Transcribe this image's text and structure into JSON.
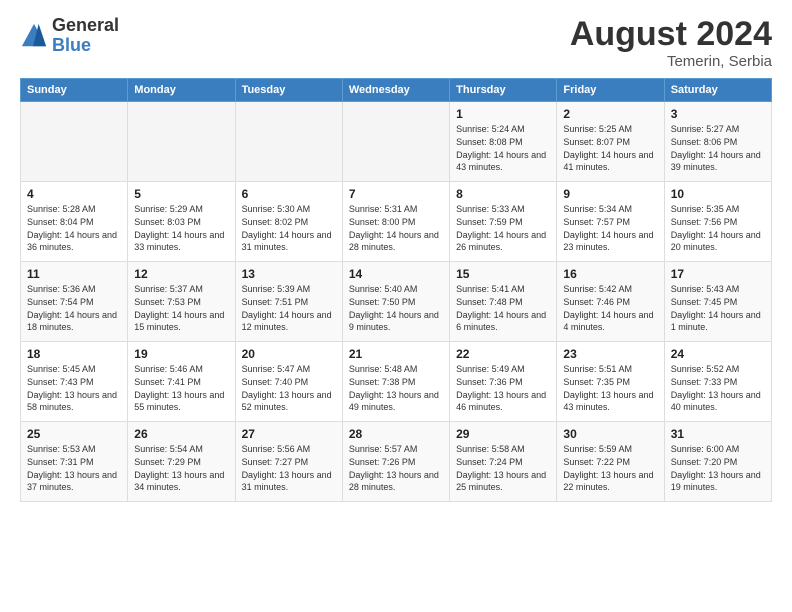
{
  "header": {
    "logo_general": "General",
    "logo_blue": "Blue",
    "month_year": "August 2024",
    "location": "Temerin, Serbia"
  },
  "weekdays": [
    "Sunday",
    "Monday",
    "Tuesday",
    "Wednesday",
    "Thursday",
    "Friday",
    "Saturday"
  ],
  "weeks": [
    [
      {
        "day": "",
        "info": ""
      },
      {
        "day": "",
        "info": ""
      },
      {
        "day": "",
        "info": ""
      },
      {
        "day": "",
        "info": ""
      },
      {
        "day": "1",
        "info": "Sunrise: 5:24 AM\nSunset: 8:08 PM\nDaylight: 14 hours and 43 minutes."
      },
      {
        "day": "2",
        "info": "Sunrise: 5:25 AM\nSunset: 8:07 PM\nDaylight: 14 hours and 41 minutes."
      },
      {
        "day": "3",
        "info": "Sunrise: 5:27 AM\nSunset: 8:06 PM\nDaylight: 14 hours and 39 minutes."
      }
    ],
    [
      {
        "day": "4",
        "info": "Sunrise: 5:28 AM\nSunset: 8:04 PM\nDaylight: 14 hours and 36 minutes."
      },
      {
        "day": "5",
        "info": "Sunrise: 5:29 AM\nSunset: 8:03 PM\nDaylight: 14 hours and 33 minutes."
      },
      {
        "day": "6",
        "info": "Sunrise: 5:30 AM\nSunset: 8:02 PM\nDaylight: 14 hours and 31 minutes."
      },
      {
        "day": "7",
        "info": "Sunrise: 5:31 AM\nSunset: 8:00 PM\nDaylight: 14 hours and 28 minutes."
      },
      {
        "day": "8",
        "info": "Sunrise: 5:33 AM\nSunset: 7:59 PM\nDaylight: 14 hours and 26 minutes."
      },
      {
        "day": "9",
        "info": "Sunrise: 5:34 AM\nSunset: 7:57 PM\nDaylight: 14 hours and 23 minutes."
      },
      {
        "day": "10",
        "info": "Sunrise: 5:35 AM\nSunset: 7:56 PM\nDaylight: 14 hours and 20 minutes."
      }
    ],
    [
      {
        "day": "11",
        "info": "Sunrise: 5:36 AM\nSunset: 7:54 PM\nDaylight: 14 hours and 18 minutes."
      },
      {
        "day": "12",
        "info": "Sunrise: 5:37 AM\nSunset: 7:53 PM\nDaylight: 14 hours and 15 minutes."
      },
      {
        "day": "13",
        "info": "Sunrise: 5:39 AM\nSunset: 7:51 PM\nDaylight: 14 hours and 12 minutes."
      },
      {
        "day": "14",
        "info": "Sunrise: 5:40 AM\nSunset: 7:50 PM\nDaylight: 14 hours and 9 minutes."
      },
      {
        "day": "15",
        "info": "Sunrise: 5:41 AM\nSunset: 7:48 PM\nDaylight: 14 hours and 6 minutes."
      },
      {
        "day": "16",
        "info": "Sunrise: 5:42 AM\nSunset: 7:46 PM\nDaylight: 14 hours and 4 minutes."
      },
      {
        "day": "17",
        "info": "Sunrise: 5:43 AM\nSunset: 7:45 PM\nDaylight: 14 hours and 1 minute."
      }
    ],
    [
      {
        "day": "18",
        "info": "Sunrise: 5:45 AM\nSunset: 7:43 PM\nDaylight: 13 hours and 58 minutes."
      },
      {
        "day": "19",
        "info": "Sunrise: 5:46 AM\nSunset: 7:41 PM\nDaylight: 13 hours and 55 minutes."
      },
      {
        "day": "20",
        "info": "Sunrise: 5:47 AM\nSunset: 7:40 PM\nDaylight: 13 hours and 52 minutes."
      },
      {
        "day": "21",
        "info": "Sunrise: 5:48 AM\nSunset: 7:38 PM\nDaylight: 13 hours and 49 minutes."
      },
      {
        "day": "22",
        "info": "Sunrise: 5:49 AM\nSunset: 7:36 PM\nDaylight: 13 hours and 46 minutes."
      },
      {
        "day": "23",
        "info": "Sunrise: 5:51 AM\nSunset: 7:35 PM\nDaylight: 13 hours and 43 minutes."
      },
      {
        "day": "24",
        "info": "Sunrise: 5:52 AM\nSunset: 7:33 PM\nDaylight: 13 hours and 40 minutes."
      }
    ],
    [
      {
        "day": "25",
        "info": "Sunrise: 5:53 AM\nSunset: 7:31 PM\nDaylight: 13 hours and 37 minutes."
      },
      {
        "day": "26",
        "info": "Sunrise: 5:54 AM\nSunset: 7:29 PM\nDaylight: 13 hours and 34 minutes."
      },
      {
        "day": "27",
        "info": "Sunrise: 5:56 AM\nSunset: 7:27 PM\nDaylight: 13 hours and 31 minutes."
      },
      {
        "day": "28",
        "info": "Sunrise: 5:57 AM\nSunset: 7:26 PM\nDaylight: 13 hours and 28 minutes."
      },
      {
        "day": "29",
        "info": "Sunrise: 5:58 AM\nSunset: 7:24 PM\nDaylight: 13 hours and 25 minutes."
      },
      {
        "day": "30",
        "info": "Sunrise: 5:59 AM\nSunset: 7:22 PM\nDaylight: 13 hours and 22 minutes."
      },
      {
        "day": "31",
        "info": "Sunrise: 6:00 AM\nSunset: 7:20 PM\nDaylight: 13 hours and 19 minutes."
      }
    ]
  ]
}
